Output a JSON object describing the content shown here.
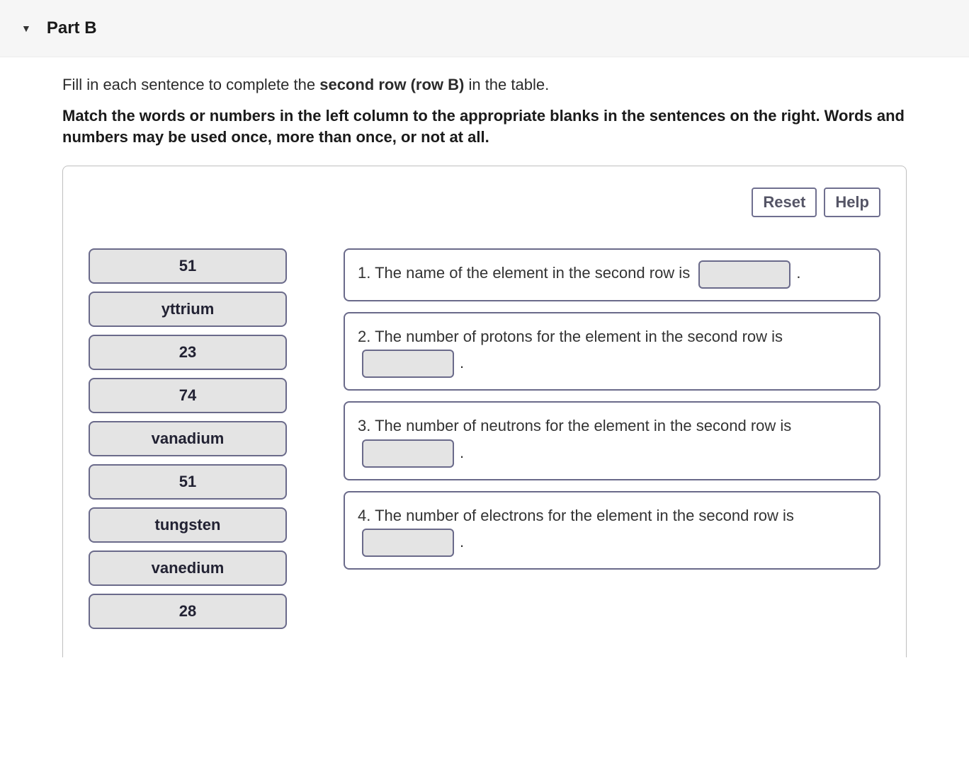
{
  "header": {
    "partLabel": "Part B"
  },
  "instructions": {
    "line1_pre": "Fill in each sentence to complete the ",
    "line1_bold": "second row (row B)",
    "line1_post": " in the table.",
    "line2": "Match the words or numbers in the left column to the appropriate blanks in the sentences on the right. Words and numbers may be used once, more than once, or not at all."
  },
  "toolbar": {
    "reset": "Reset",
    "help": "Help"
  },
  "tiles": [
    "51",
    "yttrium",
    "23",
    "74",
    "vanadium",
    "51",
    "tungsten",
    "vanedium",
    "28"
  ],
  "sentences": [
    {
      "pre": "1. The name of the element in the second row is ",
      "post": "."
    },
    {
      "pre": "2. The number of protons for the element in the second row is ",
      "post": "."
    },
    {
      "pre": "3. The number of neutrons for the element in the second row is ",
      "post": "."
    },
    {
      "pre": "4. The number of electrons for the element in the second row is ",
      "post": "."
    }
  ]
}
